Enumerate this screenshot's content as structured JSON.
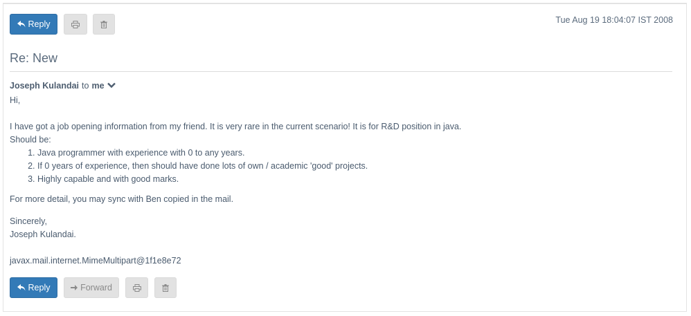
{
  "toolbar_top": {
    "reply_label": "Reply",
    "print_icon": "print-icon",
    "trash_icon": "trash-icon"
  },
  "message": {
    "date": "Tue Aug 19 18:04:07 IST 2008",
    "subject": "Re: New",
    "sender": "Joseph Kulandai",
    "to_word": "to",
    "recipient": "me",
    "greeting": "Hi,",
    "para1": "I have got a job opening information from my friend. It is very rare in the current scenario! It is for R&D position in java.",
    "should_be": "Should be:",
    "requirements": [
      "Java programmer with experience with 0 to any years.",
      "If 0 years of experience, then should have done lots of own / academic 'good' projects.",
      "Highly capable and with good marks."
    ],
    "para2": "For more detail, you may sync with Ben copied in the mail.",
    "closing": "Sincerely,",
    "signature": "Joseph Kulandai.",
    "mime": "javax.mail.internet.MimeMultipart@1f1e8e72"
  },
  "toolbar_bottom": {
    "reply_label": "Reply",
    "forward_label": "Forward"
  },
  "colors": {
    "primary": "#337ab7",
    "default_button": "#e2e2e2",
    "text": "#4a5b6e"
  }
}
